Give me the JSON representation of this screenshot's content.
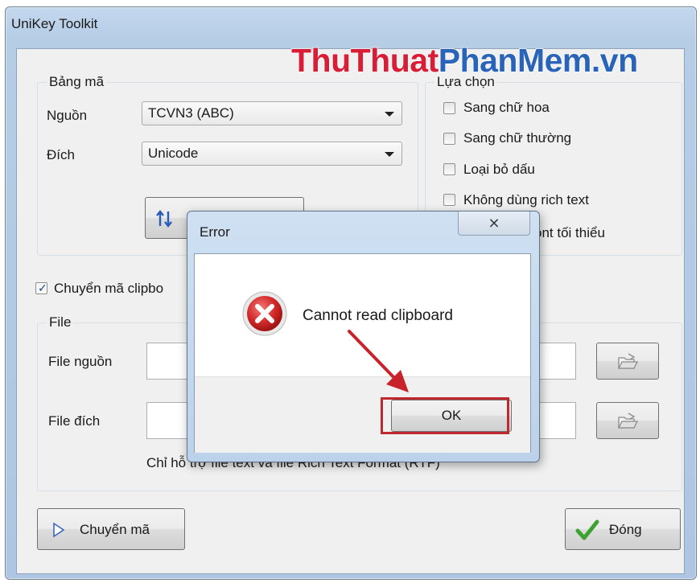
{
  "window": {
    "title": "UniKey Toolkit"
  },
  "watermark": {
    "part1": "ThuThuat",
    "part2": "PhanMem.vn"
  },
  "bang_ma": {
    "group_label": "Bảng mã",
    "source_label": "Nguồn",
    "source_value": "TCVN3 (ABC)",
    "target_label": "Đích",
    "target_value": "Unicode"
  },
  "options": {
    "group_label": "Lựa chọn",
    "items": [
      {
        "label": "Sang chữ hoa",
        "checked": false
      },
      {
        "label": "Sang chữ thường",
        "checked": false
      },
      {
        "label": "Loại bỏ dấu",
        "checked": false
      },
      {
        "label": "Không dùng rich text",
        "checked": false
      },
      {
        "label": "ont tối thiểu",
        "checked": false
      }
    ]
  },
  "clipboard": {
    "label": "Chuyển mã clipbo",
    "checked": true
  },
  "file": {
    "group_label": "File",
    "source_label": "File nguồn",
    "target_label": "File đích",
    "note": "Chỉ hỗ trợ file text và file Rich Text Format (RTF)"
  },
  "buttons": {
    "convert": "Chuyển mã",
    "close": "Đóng"
  },
  "dialog": {
    "title": "Error",
    "close_glyph": "⨯",
    "message": "Cannot read clipboard",
    "ok_label": "OK"
  },
  "colors": {
    "highlight": "#c0282f",
    "arrow": "#c8232b",
    "error_icon": "#d42a2a",
    "watermark_red": "#d81e37",
    "watermark_blue": "#2a64b8"
  },
  "icons": {
    "swap": "swap-arrows-icon",
    "folder": "folder-open-icon",
    "play": "play-triangle-icon",
    "check": "green-check-icon",
    "error": "error-x-icon"
  }
}
